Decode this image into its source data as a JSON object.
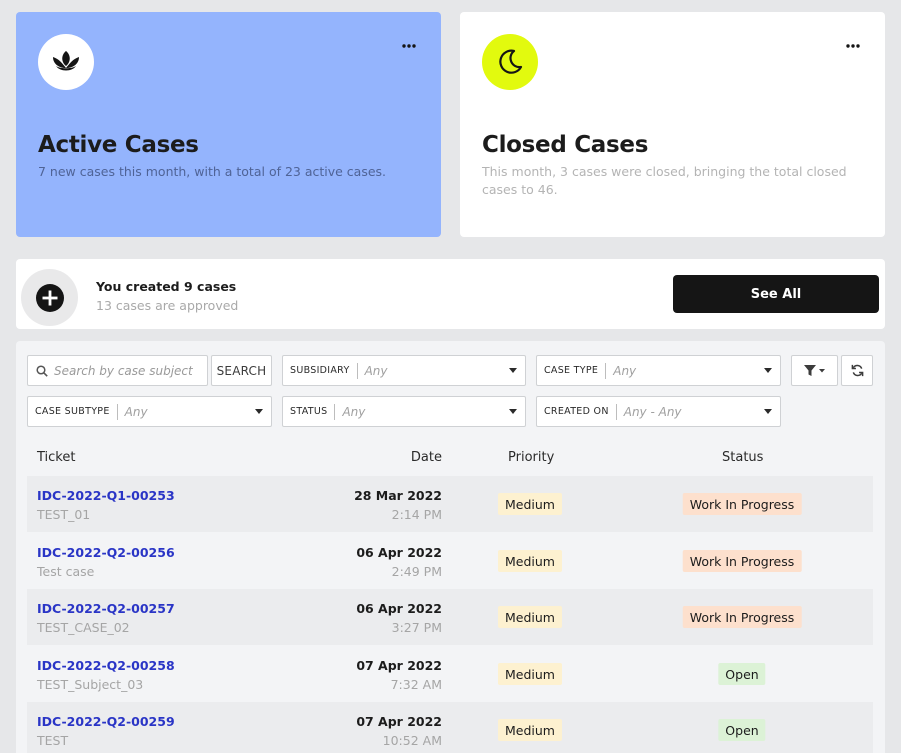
{
  "cards": {
    "active": {
      "title": "Active Cases",
      "description": "7 new cases this month, with a total of 23 active cases.",
      "icon": "lotus-icon",
      "color": "#94b4fd"
    },
    "closed": {
      "title": "Closed Cases",
      "description": "This month, 3 cases were closed, bringing the total closed cases to 46.",
      "icon": "moon-icon",
      "color": "#e2fa0e"
    }
  },
  "created": {
    "title": "You created 9 cases",
    "subtitle": "13 cases are approved",
    "see_all_label": "See All"
  },
  "filters": {
    "search_placeholder": "Search by case subject",
    "search_button": "SEARCH",
    "subsidiary": {
      "label": "SUBSIDIARY",
      "value": "Any"
    },
    "case_type": {
      "label": "CASE TYPE",
      "value": "Any"
    },
    "case_subtype": {
      "label": "CASE SUBTYPE",
      "value": "Any"
    },
    "status": {
      "label": "STATUS",
      "value": "Any"
    },
    "created_on": {
      "label": "CREATED ON",
      "value": "Any - Any"
    }
  },
  "table": {
    "headers": {
      "ticket": "Ticket",
      "date": "Date",
      "priority": "Priority",
      "status": "Status"
    },
    "rows": [
      {
        "id": "IDC-2022-Q1-00253",
        "subject": "TEST_01",
        "date": "28 Mar 2022",
        "time": "2:14 PM",
        "priority": "Medium",
        "status": "Work In Progress"
      },
      {
        "id": "IDC-2022-Q2-00256",
        "subject": "Test case",
        "date": "06 Apr 2022",
        "time": "2:49 PM",
        "priority": "Medium",
        "status": "Work In Progress"
      },
      {
        "id": "IDC-2022-Q2-00257",
        "subject": "TEST_CASE_02",
        "date": "06 Apr 2022",
        "time": "3:27 PM",
        "priority": "Medium",
        "status": "Work In Progress"
      },
      {
        "id": "IDC-2022-Q2-00258",
        "subject": "TEST_Subject_03",
        "date": "07 Apr 2022",
        "time": "7:32 AM",
        "priority": "Medium",
        "status": "Open"
      },
      {
        "id": "IDC-2022-Q2-00259",
        "subject": "TEST",
        "date": "07 Apr 2022",
        "time": "10:52 AM",
        "priority": "Medium",
        "status": "Open"
      }
    ]
  },
  "colors": {
    "link": "#2a35c6",
    "wip": "#fde0cd",
    "open": "#dcf2d6",
    "medium": "#fdf1d0"
  }
}
